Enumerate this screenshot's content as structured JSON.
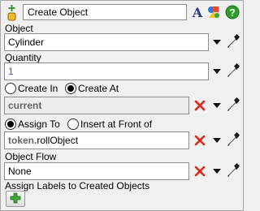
{
  "header": {
    "title": "Create Object"
  },
  "object": {
    "label": "Object",
    "value": "Cylinder"
  },
  "quantity": {
    "label": "Quantity",
    "value": "1"
  },
  "create_mode": {
    "option_in": "Create In",
    "option_at": "Create At",
    "selected": "Create At",
    "value": "current"
  },
  "assign_mode": {
    "option_assign": "Assign To",
    "option_insert": "Insert at Front of",
    "selected": "Assign To",
    "value_bold": "token.",
    "value_rest": "rollObject"
  },
  "object_flow": {
    "label": "Object Flow",
    "value": "None"
  },
  "labels_section": {
    "label": "Assign Labels to Created Objects"
  },
  "icons": [
    "activity-icon",
    "font-icon",
    "graphics-icon",
    "help-icon",
    "dropdown-arrow-icon",
    "eyedropper-icon",
    "clear-x-icon",
    "add-plus-icon"
  ],
  "colors": {
    "accent_green": "#3fa535",
    "clear_red": "#e0261b",
    "help_green": "#2e9d2e",
    "value_purple": "#8a2be2"
  }
}
